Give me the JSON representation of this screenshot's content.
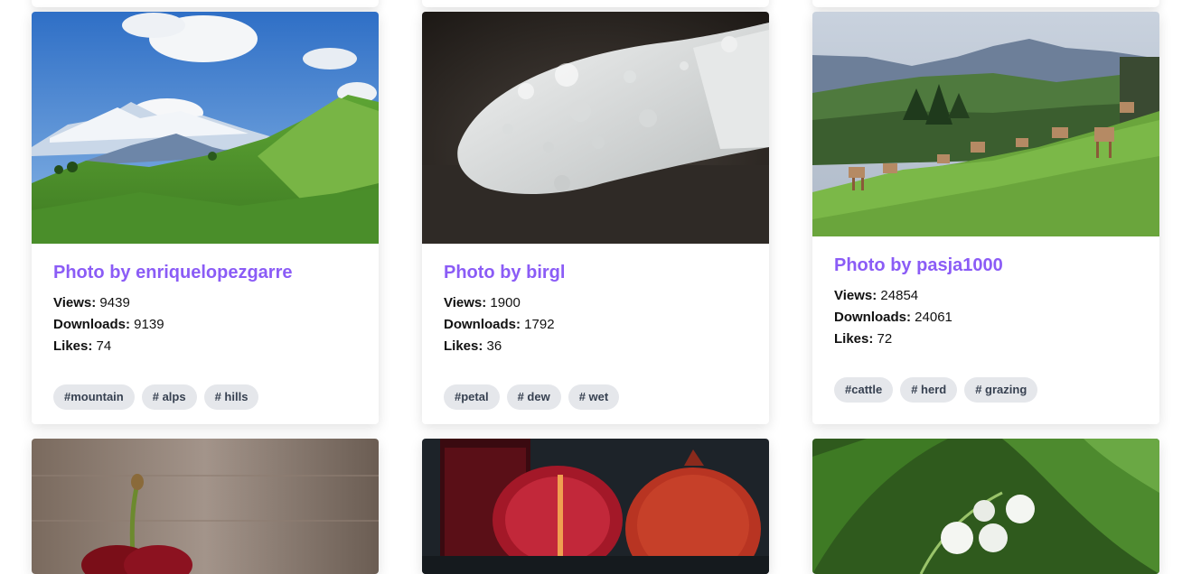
{
  "cards": [
    {
      "title": "Photo by enriquelopezgarre",
      "views_label": "Views:",
      "views": "9439",
      "downloads_label": "Downloads:",
      "downloads": "9139",
      "likes_label": "Likes:",
      "likes": "74",
      "tags": [
        "#mountain",
        "# alps",
        "# hills"
      ]
    },
    {
      "title": "Photo by birgl",
      "views_label": "Views:",
      "views": "1900",
      "downloads_label": "Downloads:",
      "downloads": "1792",
      "likes_label": "Likes:",
      "likes": "36",
      "tags": [
        "#petal",
        "# dew",
        "# wet"
      ]
    },
    {
      "title": "Photo by pasja1000",
      "views_label": "Views:",
      "views": "24854",
      "downloads_label": "Downloads:",
      "downloads": "24061",
      "likes_label": "Likes:",
      "likes": "72",
      "tags": [
        "#cattle",
        "# herd",
        "# grazing"
      ]
    }
  ],
  "colors": {
    "title": "#8b5cf6",
    "tag_bg": "#e5e7eb",
    "tag_text": "#374151"
  }
}
